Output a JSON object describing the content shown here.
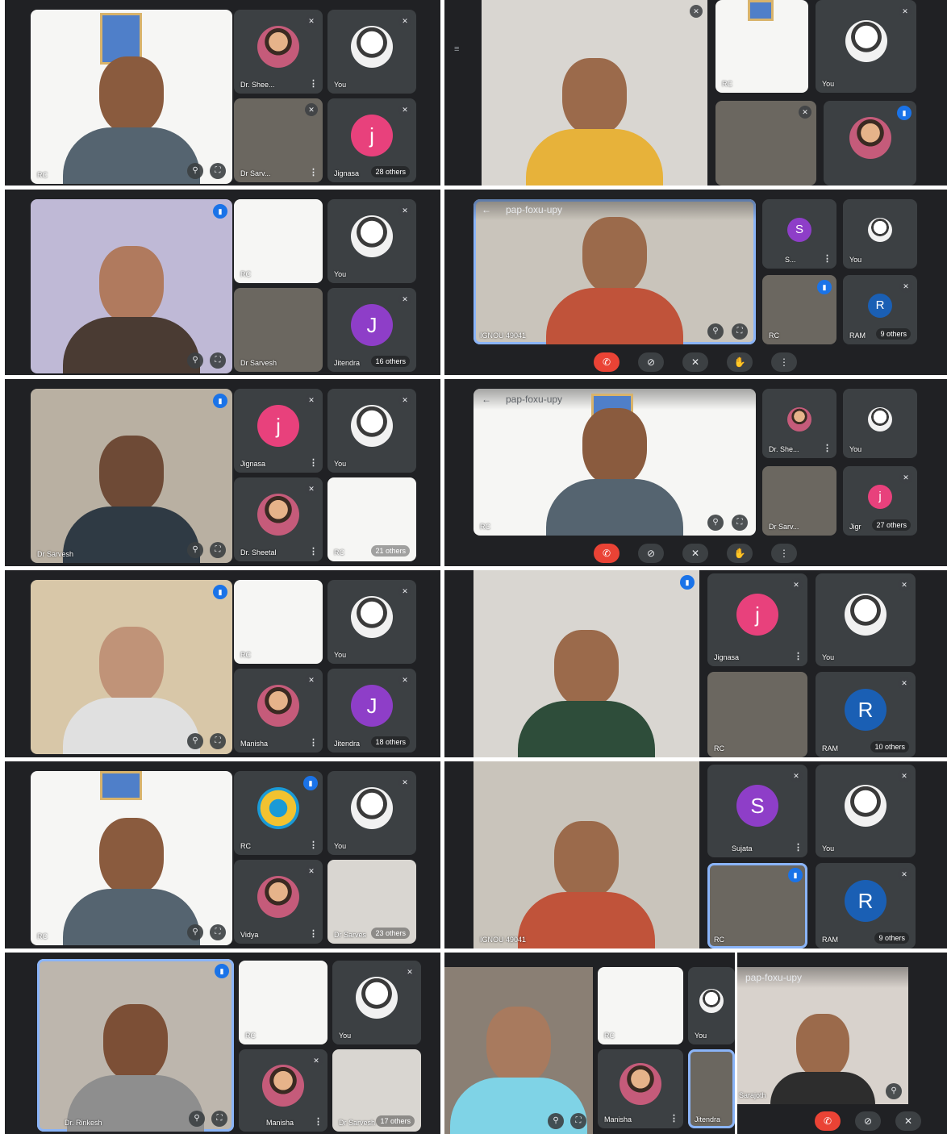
{
  "labels": {
    "you": "You",
    "rc": "RC",
    "dr_shee": "Dr. Shee...",
    "dr_she": "Dr. She...",
    "dr_sheetal": "Dr. Sheetal",
    "dr_sarv": "Dr Sarv...",
    "dr_sarvesh": "Dr Sarvesh",
    "dr_sarves": "Dr Sarves",
    "dr_sarvesh_short": "Dr Sarvesh",
    "jignasa": "Jignasa",
    "jig": "Jigr",
    "jitendra": "Jitendra",
    "manisha": "Manisha",
    "vidya": "Vidya",
    "sujata": "Sujata",
    "ram": "RAM",
    "ram_short": "RAM",
    "s_short": "S...",
    "dr_rinkesh": "Dr. Rinkesh",
    "ignou": "IGNOU 49041",
    "sarajoth": "Sarajoth"
  },
  "others": {
    "o28": "28 others",
    "o16": "16 others",
    "o9": "9 others",
    "o21": "21 others",
    "o27": "27 others",
    "o18": "18 others",
    "o10": "10 others",
    "o23": "23 others",
    "o9b": "9 others",
    "o17": "17 others"
  },
  "meeting": {
    "code": "pap-foxu-upy"
  },
  "avatars": {
    "j": "j",
    "J": "J",
    "S": "S",
    "R": "R"
  },
  "icons": {
    "mic_off": "mic-off-icon",
    "speaking": "audio-level-icon",
    "more": "more-vert-icon",
    "pin": "pin-icon",
    "expand": "fullscreen-icon",
    "end_call": "end-call-icon",
    "camera_off": "camera-off-icon",
    "raise_hand": "hand-icon",
    "back": "back-arrow-icon"
  },
  "colors": {
    "meet_bg": "#202124",
    "tile_bg": "#3c4043",
    "accent_blue": "#1a73e8",
    "end_red": "#ea4335",
    "pink_avatar": "#e8417c",
    "purple_avatar": "#8e3ec8",
    "blue_avatar": "#1a5fb4"
  }
}
